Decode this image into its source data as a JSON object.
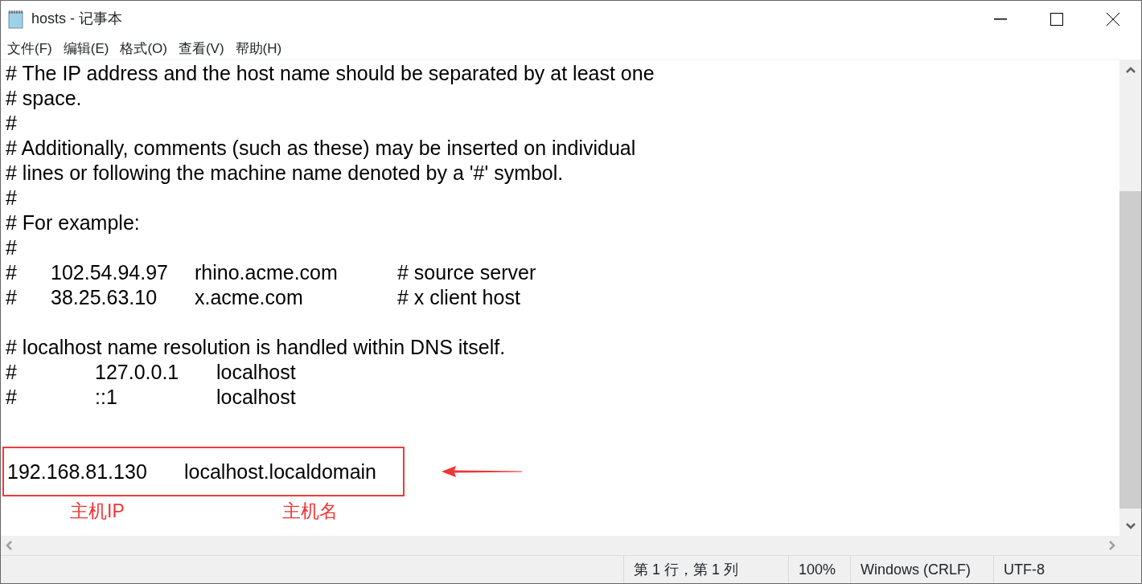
{
  "window": {
    "title": "hosts - 记事本"
  },
  "menu": [
    "文件(F)",
    "编辑(E)",
    "格式(O)",
    "查看(V)",
    "帮助(H)"
  ],
  "lines": [
    {
      "kind": "text",
      "segments": [
        "# The IP address and the host name should be separated by at least one"
      ]
    },
    {
      "kind": "text",
      "segments": [
        "# space."
      ]
    },
    {
      "kind": "text",
      "segments": [
        "#"
      ]
    },
    {
      "kind": "text",
      "segments": [
        "# Additionally, comments (such as these) may be inserted on individual"
      ]
    },
    {
      "kind": "text",
      "segments": [
        "# lines or following the machine name denoted by a '#' symbol."
      ]
    },
    {
      "kind": "text",
      "segments": [
        "#"
      ]
    },
    {
      "kind": "text",
      "segments": [
        "# For example:"
      ]
    },
    {
      "kind": "text",
      "segments": [
        "#"
      ]
    },
    {
      "kind": "example",
      "segments": [
        "#",
        "102.54.94.97",
        "rhino.acme.com",
        "# source server"
      ]
    },
    {
      "kind": "example",
      "segments": [
        "#",
        "38.25.63.10",
        "x.acme.com",
        "# x client host"
      ]
    },
    {
      "kind": "blank"
    },
    {
      "kind": "text",
      "segments": [
        "# localhost name resolution is handled within DNS itself."
      ]
    },
    {
      "kind": "loopback",
      "segments": [
        "#",
        "127.0.0.1",
        "localhost"
      ]
    },
    {
      "kind": "loopback",
      "segments": [
        "#",
        "::1",
        "localhost"
      ]
    },
    {
      "kind": "blank"
    },
    {
      "kind": "blank"
    },
    {
      "kind": "highlight",
      "segments": [
        "192.168.81.130",
        "localhost.localdomain"
      ]
    }
  ],
  "annotations": [
    "主机IP",
    "主机名"
  ],
  "status_bar": [
    "第 1 行，第 1 列",
    "100%",
    "Windows (CRLF)",
    "UTF-8"
  ]
}
